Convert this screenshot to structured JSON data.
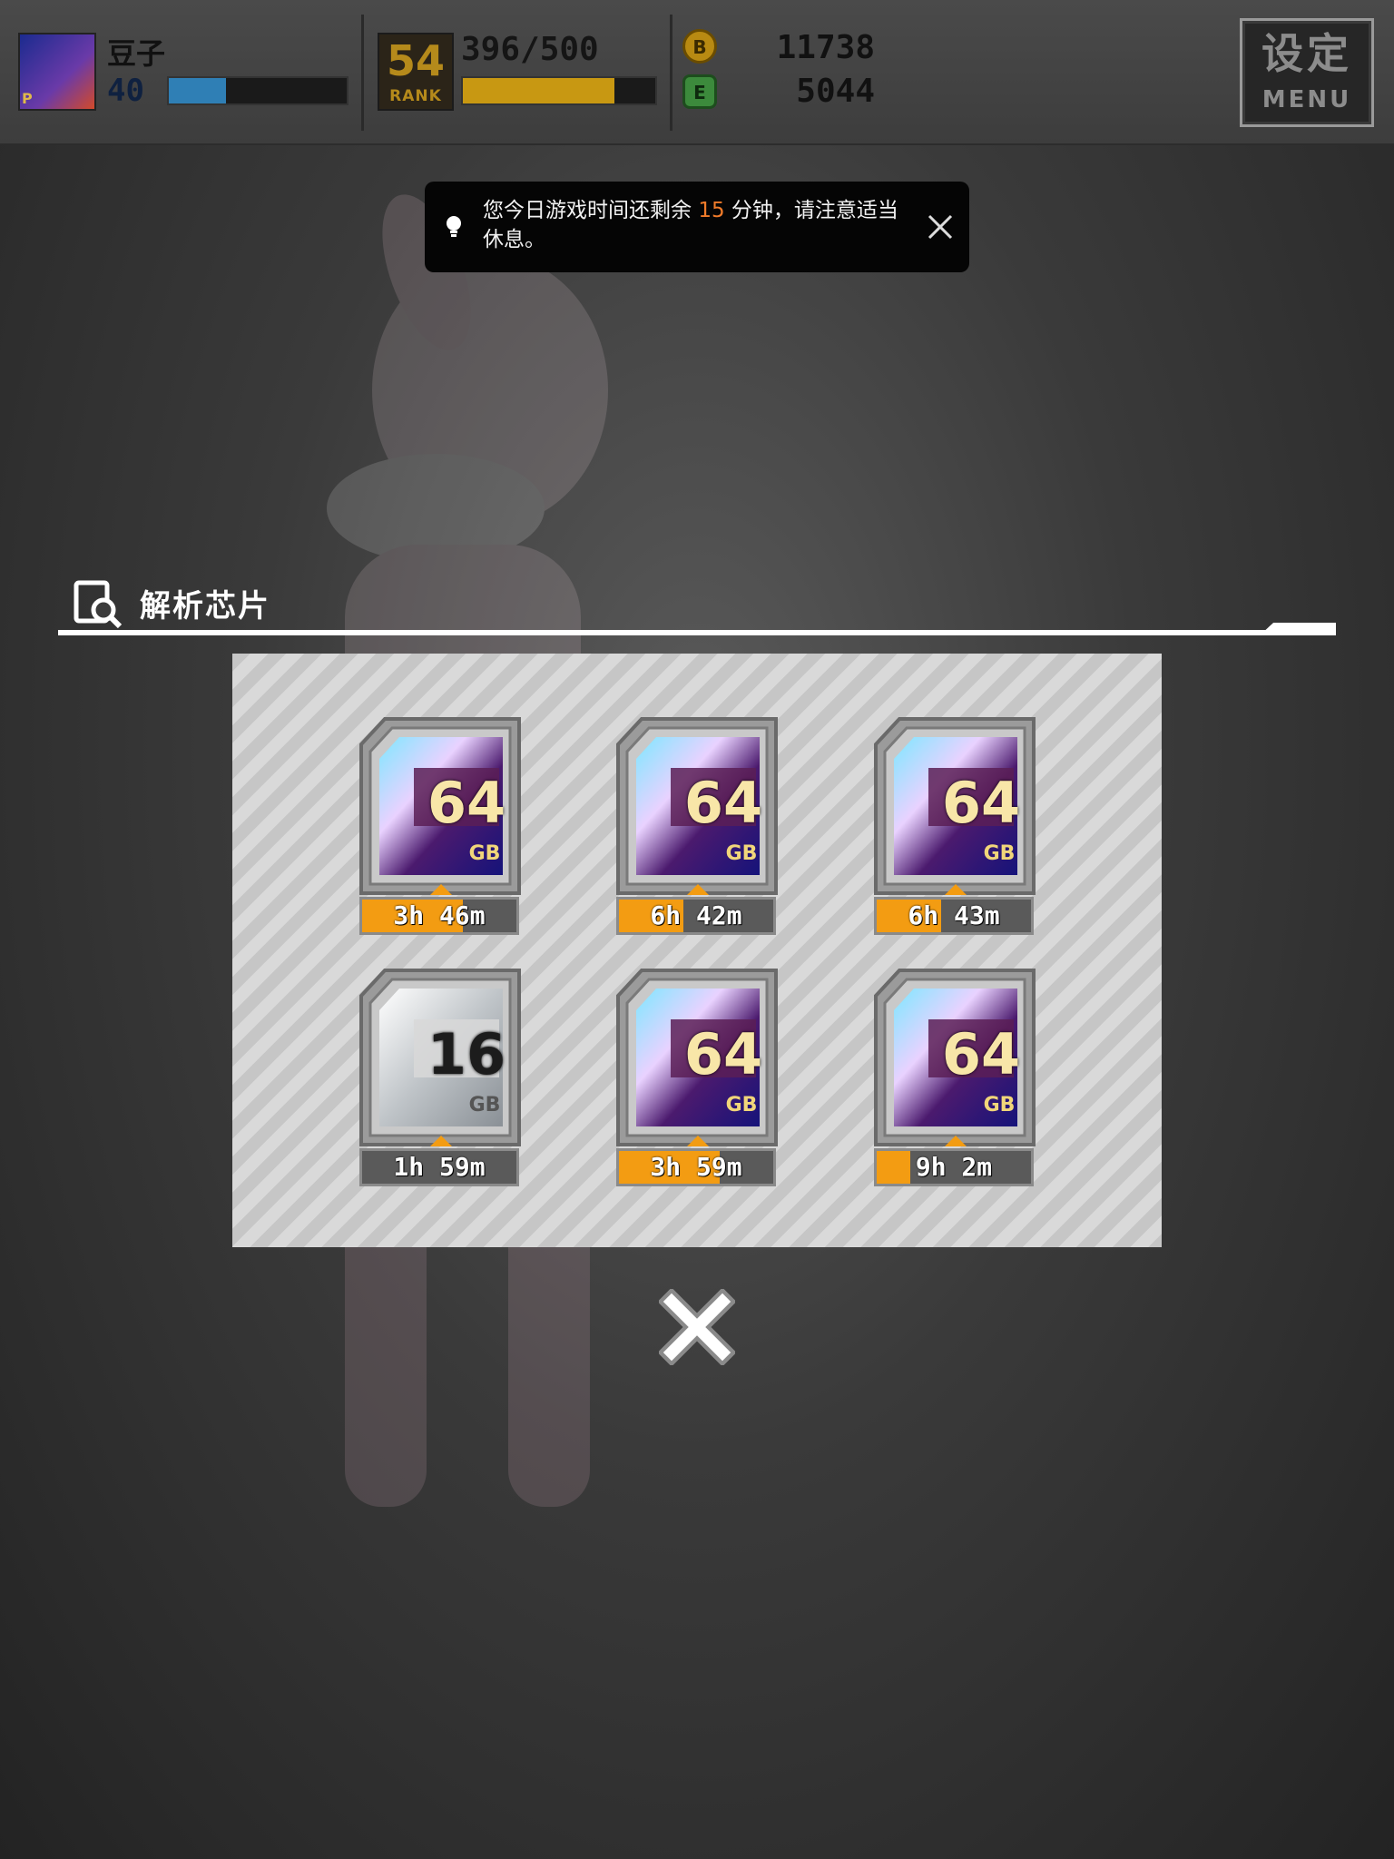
{
  "hud": {
    "player_name": "豆子",
    "player_level": "40",
    "exp_fraction": 0.32,
    "rank_number": "54",
    "rank_label": "RANK",
    "rank_progress": "396/500",
    "rank_fraction": 0.79,
    "currency_b_icon": "B",
    "currency_b_value": "11738",
    "currency_e_icon": "E",
    "currency_e_value": "5044",
    "menu_title": "设定",
    "menu_sub": "MENU"
  },
  "toast": {
    "text_before": "您今日游戏时间还剩余 ",
    "highlight": "15",
    "text_after": " 分钟，请注意适当休息。",
    "highlight_color": "#f07b2a"
  },
  "section": {
    "title": "解析芯片"
  },
  "chips": [
    {
      "capacity": "64",
      "unit": "GB",
      "timer": "3h 46m",
      "progress": 0.65,
      "kind": "gold"
    },
    {
      "capacity": "64",
      "unit": "GB",
      "timer": "6h 42m",
      "progress": 0.42,
      "kind": "gold"
    },
    {
      "capacity": "64",
      "unit": "GB",
      "timer": "6h 43m",
      "progress": 0.42,
      "kind": "gold"
    },
    {
      "capacity": "16",
      "unit": "GB",
      "timer": "1h 59m",
      "progress": 0.0,
      "kind": "silver"
    },
    {
      "capacity": "64",
      "unit": "GB",
      "timer": "3h 59m",
      "progress": 0.65,
      "kind": "gold"
    },
    {
      "capacity": "64",
      "unit": "GB",
      "timer": "9h 2m",
      "progress": 0.22,
      "kind": "gold"
    }
  ],
  "colors": {
    "timer_fill": "#f39c12",
    "exp_bar": "#2f7fb5",
    "rank_bar": "#c89812"
  }
}
